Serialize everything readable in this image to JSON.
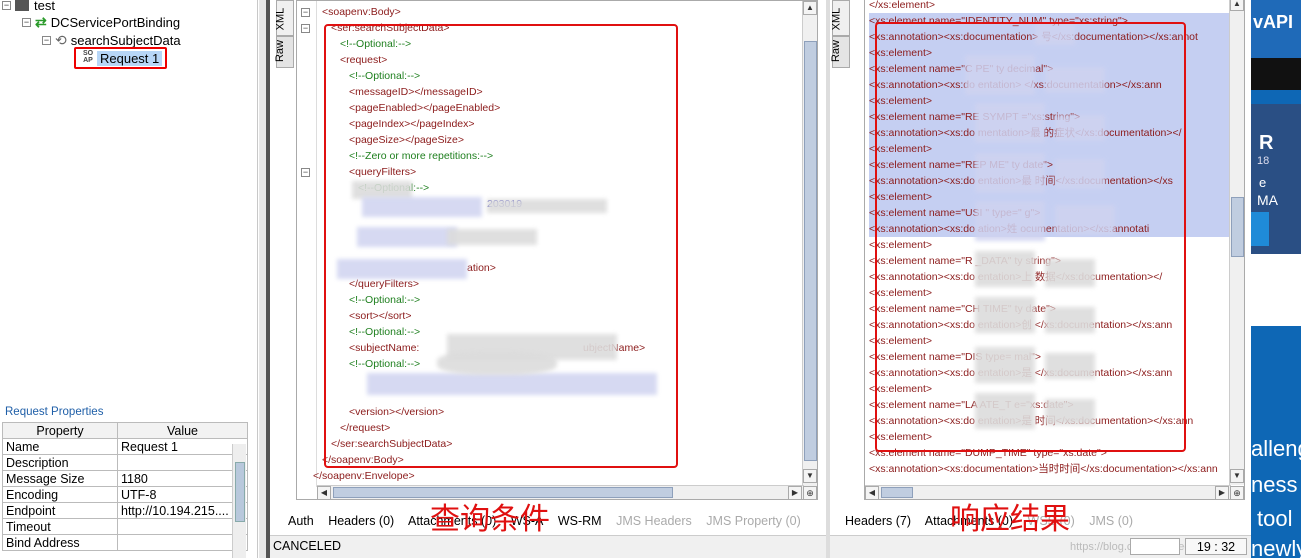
{
  "tree": {
    "root": "test",
    "binding": "DCServicePortBinding",
    "operation": "searchSubjectData",
    "request": "Request 1",
    "soap_icon_top": "SO",
    "soap_icon_bottom": "AP"
  },
  "properties": {
    "title": "Request Properties",
    "headers": [
      "Property",
      "Value"
    ],
    "rows": [
      {
        "name": "Name",
        "value": "Request 1"
      },
      {
        "name": "Description",
        "value": ""
      },
      {
        "name": "Message Size",
        "value": "1180"
      },
      {
        "name": "Encoding",
        "value": "UTF-8"
      },
      {
        "name": "Endpoint",
        "value": "http://10.194.215...."
      },
      {
        "name": "Timeout",
        "value": ""
      },
      {
        "name": "Bind Address",
        "value": ""
      }
    ]
  },
  "request_editor": {
    "side_tabs": [
      "XML",
      "Raw"
    ],
    "lines": [
      "<soapenv:Body>",
      "<ser:searchSubjectData>",
      "<!--Optional:-->",
      "<request>",
      "<!--Optional:-->",
      "<messageID></messageID>",
      "<pageEnabled></pageEnabled>",
      "<pageIndex></pageIndex>",
      "<pageSize></pageSize>",
      "<!--Zero or more repetitions:-->",
      "<queryFilters>",
      "<!--Optional:-->",
      "203019",
      "",
      "ation>",
      "</queryFilters>",
      "<!--Optional:-->",
      "<sort></sort>",
      "<!--Optional:-->",
      "<subjectName:",
      "<!--Optional:-->",
      "",
      "",
      "<version></version>",
      "</request>",
      "</ser:searchSubjectData>",
      "</soapenv:Body>",
      "</soapenv:Envelope>"
    ],
    "subject_close": "ubjectName>",
    "bottom_tabs": [
      "Auth",
      "Headers (0)",
      "Attachments (0)",
      "WS-A",
      "WS-RM",
      "JMS Headers",
      "JMS Property (0)"
    ],
    "annotation": "查询条件",
    "status": "CANCELED"
  },
  "response_editor": {
    "side_tabs": [
      "XML",
      "Raw"
    ],
    "lines": [
      "</xs:element>",
      "<xs:element name=\"IDENTITY_NUM\" type=\"xs:string\">",
      "<xs:annotation><xs:documentation>        号</xs:documentation></xs:annot",
      "<xs:element>",
      "<xs:element name=\"C          PE\" ty        decimal\">",
      "<xs:annotation><xs:do         entation>          </xs:documentation></xs:ann",
      "<xs:element>",
      "<xs:element name=\"RE          SYMPT          =\"xs:string\">",
      "<xs:annotation><xs:do         mentation>最         的症状</xs:documentation></",
      "<xs:element>",
      "<xs:element name=\"REP          ME\" ty          date\">",
      "<xs:annotation><xs:do         entation>最         时间</xs:documentation></xs",
      "<xs:element>",
      "<xs:element name=\"USI          \" type=\"          g\">",
      "<xs:annotation><xs:do         ation>姓         ocumentation></xs:annotati",
      "<xs:element>",
      "<xs:element name=\"R          _DATA\" ty         string\">",
      "<xs:annotation><xs:do          entation>上         数据</xs:documentation></",
      "<xs:element>",
      "<xs:element name=\"CH          TIME\" ty          date\">",
      "<xs:annotation><xs:do          entation>创          </xs:documentation></xs:ann",
      "<xs:element>",
      "<xs:element name=\"DIS          type=          mal\">",
      "<xs:annotation><xs:do          entation>是          </xs:documentation></xs:ann",
      "<xs:element>",
      "<xs:element name=\"LA          ATE_T          e=\"xs:date\">",
      "<xs:annotation><xs:do          entation>是          时间</xs:documentation></xs:ann",
      "<xs:element>",
      "<xs:element name=\"DUMP_TIME\" type=\"xs:date\">",
      "<xs:annotation><xs:documentation>当时时间</xs:documentation></xs:ann"
    ],
    "bottom_tabs": [
      "Headers (7)",
      "Attachments (0)",
      "WSS (0)",
      "JMS (0)"
    ],
    "annotation": "响应结果",
    "position": "19 : 32",
    "watermark": "https://blog.csdn.net/VectorJ"
  },
  "background_ad": {
    "fragments": [
      "vAPI",
      "R",
      "18",
      "e",
      "MA",
      "alleng",
      "ness",
      "tool",
      "newly"
    ]
  }
}
